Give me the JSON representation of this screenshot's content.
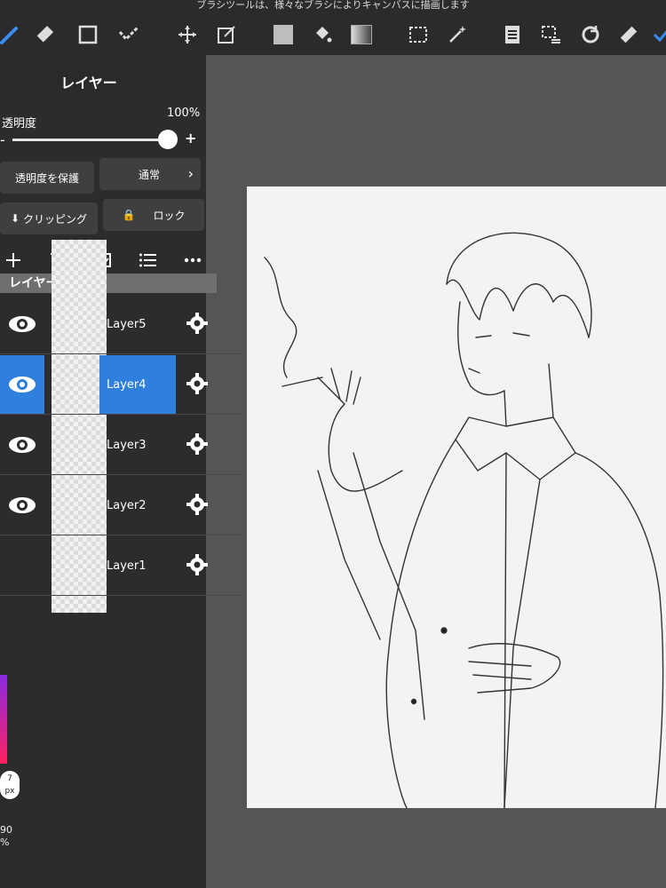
{
  "top_hint": "ブラシツールは、様々なブラシによりキャンバスに描画します",
  "panel": {
    "title": "レイヤー",
    "opacity_label": "透明度",
    "opacity_value": "100%",
    "opacity_level": 1.0,
    "protect_alpha_label": "透明度を保護",
    "blend_mode_label": "通常",
    "clipping_label": "クリッピング",
    "lock_label": "ロック",
    "list_title": "レイヤー一覧"
  },
  "layers": [
    {
      "name": "Layer5",
      "visible": true,
      "selected": false
    },
    {
      "name": "Layer4",
      "visible": true,
      "selected": true
    },
    {
      "name": "Layer3",
      "visible": true,
      "selected": false
    },
    {
      "name": "Layer2",
      "visible": true,
      "selected": false
    },
    {
      "name": "Layer1",
      "visible": false,
      "selected": false
    }
  ],
  "brush": {
    "size_value": "7",
    "size_unit": "px",
    "opacity_value": "90",
    "opacity_unit": "%"
  },
  "colors": {
    "accent": "#2f7fdc",
    "panel_bg": "#2c2c2e",
    "canvas_bg": "#555557",
    "paper": "#f3f3f3"
  }
}
